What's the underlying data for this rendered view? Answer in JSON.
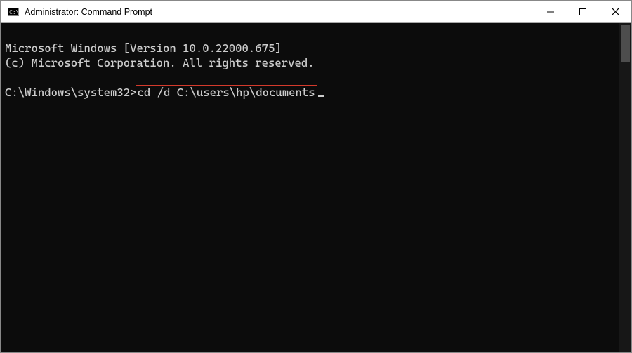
{
  "titlebar": {
    "title": "Administrator: Command Prompt",
    "controls": {
      "minimize": "minimize",
      "maximize": "maximize",
      "close": "close"
    }
  },
  "terminal": {
    "line1": "Microsoft Windows [Version 10.0.22000.675]",
    "line2": "(c) Microsoft Corporation. All rights reserved.",
    "blank1": "",
    "prompt_path": "C:\\Windows\\system32>",
    "command": "cd /d C:\\users\\hp\\documents"
  }
}
